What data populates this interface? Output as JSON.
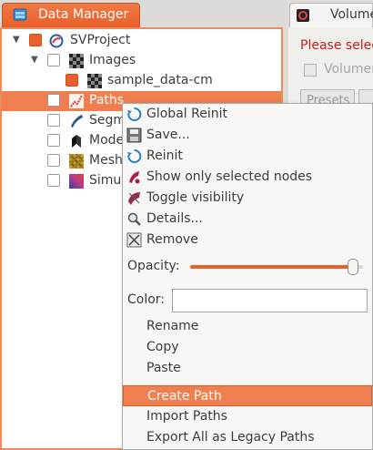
{
  "tabs": {
    "data_manager": "Data Manager",
    "volume": "Volume"
  },
  "props": {
    "warning": "Please selec",
    "checkbox_label": "Volumer",
    "presets_button": "Presets"
  },
  "tree": {
    "project": "SVProject",
    "images": "Images",
    "image_item": "sample_data-cm",
    "paths": "Paths",
    "segmentations": "Segm",
    "models": "Mode",
    "meshes": "Meshe",
    "simulations": "Simul"
  },
  "menu": {
    "global_reinit": "Global Reinit",
    "save": "Save...",
    "reinit": "Reinit",
    "show_selected": "Show only selected nodes",
    "toggle_visibility": "Toggle visibility",
    "details": "Details...",
    "remove": "Remove",
    "opacity_label": "Opacity:",
    "opacity_value": 0.97,
    "color_label": "Color:",
    "rename": "Rename",
    "copy": "Copy",
    "paste": "Paste",
    "create_path": "Create Path",
    "import_paths": "Import Paths",
    "export_legacy": "Export All as Legacy Paths"
  },
  "colors": {
    "accent": "#ef7f4f",
    "accent_dark": "#e8602b",
    "warning": "#c81e1e"
  }
}
